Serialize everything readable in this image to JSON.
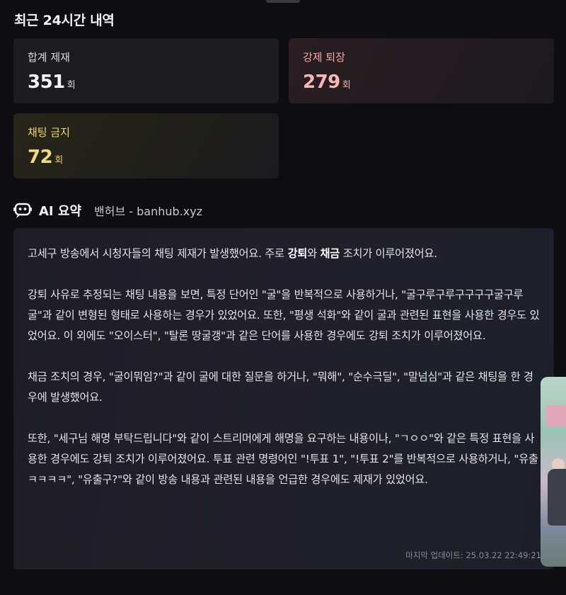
{
  "section_title": "최근 24시간 내역",
  "stats": {
    "total": {
      "label": "합계 제재",
      "value": "351",
      "unit": "회"
    },
    "kick": {
      "label": "강제 퇴장",
      "value": "279",
      "unit": "회"
    },
    "chat_ban": {
      "label": "채팅 금지",
      "value": "72",
      "unit": "회"
    }
  },
  "ai_summary": {
    "title": "AI 요약",
    "source": "밴허브 - banhub.xyz",
    "p1_a": "고세구 방송에서 시청자들의 채팅 제재가 발생했어요. 주로 ",
    "p1_b": "강퇴",
    "p1_c": "와 ",
    "p1_d": "채금",
    "p1_e": " 조치가 이루어졌어요.",
    "p2": "강퇴 사유로 추정되는 채팅 내용을 보면, 특정 단어인 \"굴\"을 반복적으로 사용하거나, \"굴구루구루구구구구굴구루굴\"과 같이 변형된 형태로 사용하는 경우가 있었어요. 또한, \"평생 석화\"와 같이 굴과 관련된 표현을 사용한 경우도 있었어요. 이 외에도 \"오이스터\", \"탈론 땅굴갱\"과 같은 단어를 사용한 경우에도 강퇴 조치가 이루어졌어요.",
    "p3": "채금 조치의 경우, \"굴이뭐임?\"과 같이 굴에 대한 질문을 하거나, \"뭐해\", \"순수극딜\", \"말넘심\"과 같은 채팅을 한 경우에 발생했어요.",
    "p4": "또한, \"세구님 해명 부탁드립니다\"와 같이 스트리머에게 해명을 요구하는 내용이나, \"ㄱㅇㅇ\"와 같은 특정 표현을 사용한 경우에도 강퇴 조치가 이루어졌어요. 투표 관련 명령어인 \"!투표 1\", \"!투표 2\"를 반복적으로 사용하거나, \"유출 ㅋㅋㅋㅋ\", \"유출구?\"와 같이 방송 내용과 관련된 내용을 언급한 경우에도 제재가 있었어요.",
    "updated": "마지막 업데이트: 25.03.22 22:49:21"
  },
  "colors": {
    "background": "#0e0e12",
    "card": "#1b1b20",
    "kick_accent": "#f3a7a7",
    "chat_ban_accent": "#f0d676"
  },
  "icons": {
    "ai": "robot-chat-icon"
  }
}
